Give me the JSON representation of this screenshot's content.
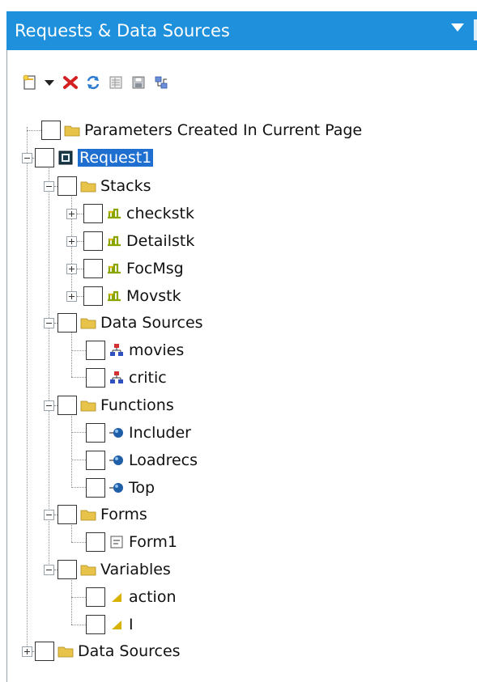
{
  "panel": {
    "title": "Requests & Data Sources"
  },
  "toolbar": {
    "icons": [
      "new-request-icon",
      "dropdown-arrow-icon",
      "delete-icon",
      "refresh-icon",
      "properties-icon",
      "save-icon",
      "link-icon"
    ]
  },
  "tree": {
    "params_label": "Parameters Created In Current Page",
    "request_label": "Request1",
    "stacks_label": "Stacks",
    "stacks": [
      "checkstk",
      "Detailstk",
      "FocMsg",
      "Movstk"
    ],
    "datasources_label": "Data Sources",
    "datasources": [
      "movies",
      "critic"
    ],
    "functions_label": "Functions",
    "functions": [
      "Includer",
      "Loadrecs",
      "Top"
    ],
    "forms_label": "Forms",
    "forms": [
      "Form1"
    ],
    "variables_label": "Variables",
    "variables": [
      "action",
      "I"
    ],
    "bottom_datasources_label": "Data Sources"
  },
  "colors": {
    "titlebar": "#1e90dc",
    "selection": "#1e6fd0",
    "folder": "#e8c34a"
  }
}
